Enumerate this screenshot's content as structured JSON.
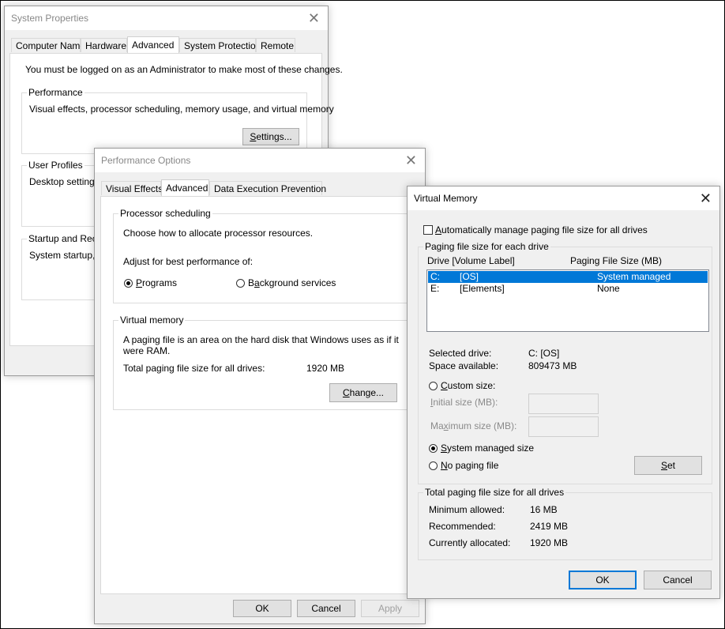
{
  "system_properties": {
    "title": "System Properties",
    "tabs": [
      "Computer Name",
      "Hardware",
      "Advanced",
      "System Protection",
      "Remote"
    ],
    "admin_note": "You must be logged on as an Administrator to make most of these changes.",
    "performance": {
      "legend": "Performance",
      "description": "Visual effects, processor scheduling, memory usage, and virtual memory",
      "settings_button": "Settings..."
    },
    "user_profiles": {
      "legend": "User Profiles",
      "description": "Desktop settings r"
    },
    "startup": {
      "legend": "Startup and Reco",
      "description": "System startup, sy"
    }
  },
  "performance_options": {
    "title": "Performance Options",
    "tabs": [
      "Visual Effects",
      "Advanced",
      "Data Execution Prevention"
    ],
    "processor_scheduling": {
      "legend": "Processor scheduling",
      "description": "Choose how to allocate processor resources.",
      "adjust_label": "Adjust for best performance of:",
      "programs": "Programs",
      "background": "Background services",
      "selected": "Programs"
    },
    "virtual_memory": {
      "legend": "Virtual memory",
      "description_line1": "A paging file is an area on the hard disk that Windows uses as if it",
      "description_line2": "were RAM.",
      "total_label": "Total paging file size for all drives:",
      "total_value": "1920 MB",
      "change_button": "Change..."
    },
    "buttons": {
      "ok": "OK",
      "cancel": "Cancel",
      "apply": "Apply"
    }
  },
  "virtual_memory_dialog": {
    "title": "Virtual Memory",
    "auto_manage_label": "Automatically manage paging file size for all drives",
    "auto_manage_checked": false,
    "group1_legend": "Paging file size for each drive",
    "list_headers": {
      "drive": "Drive  [Volume Label]",
      "size": "Paging File Size (MB)"
    },
    "drives": [
      {
        "drive": "C:",
        "label": "[OS]",
        "size": "System managed",
        "selected": true
      },
      {
        "drive": "E:",
        "label": "[Elements]",
        "size": "None",
        "selected": false
      }
    ],
    "selected_drive_label": "Selected drive:",
    "selected_drive_value": "C:  [OS]",
    "space_available_label": "Space available:",
    "space_available_value": "809473 MB",
    "custom_size": "Custom size:",
    "initial_size": "Initial size (MB):",
    "maximum_size": "Maximum size (MB):",
    "system_managed": "System managed size",
    "no_paging": "No paging file",
    "paging_mode": "System managed size",
    "set_button": "Set",
    "totals": {
      "legend": "Total paging file size for all drives",
      "minimum_label": "Minimum allowed:",
      "minimum_value": "16 MB",
      "recommended_label": "Recommended:",
      "recommended_value": "2419 MB",
      "allocated_label": "Currently allocated:",
      "allocated_value": "1920 MB"
    },
    "buttons": {
      "ok": "OK",
      "cancel": "Cancel"
    }
  }
}
